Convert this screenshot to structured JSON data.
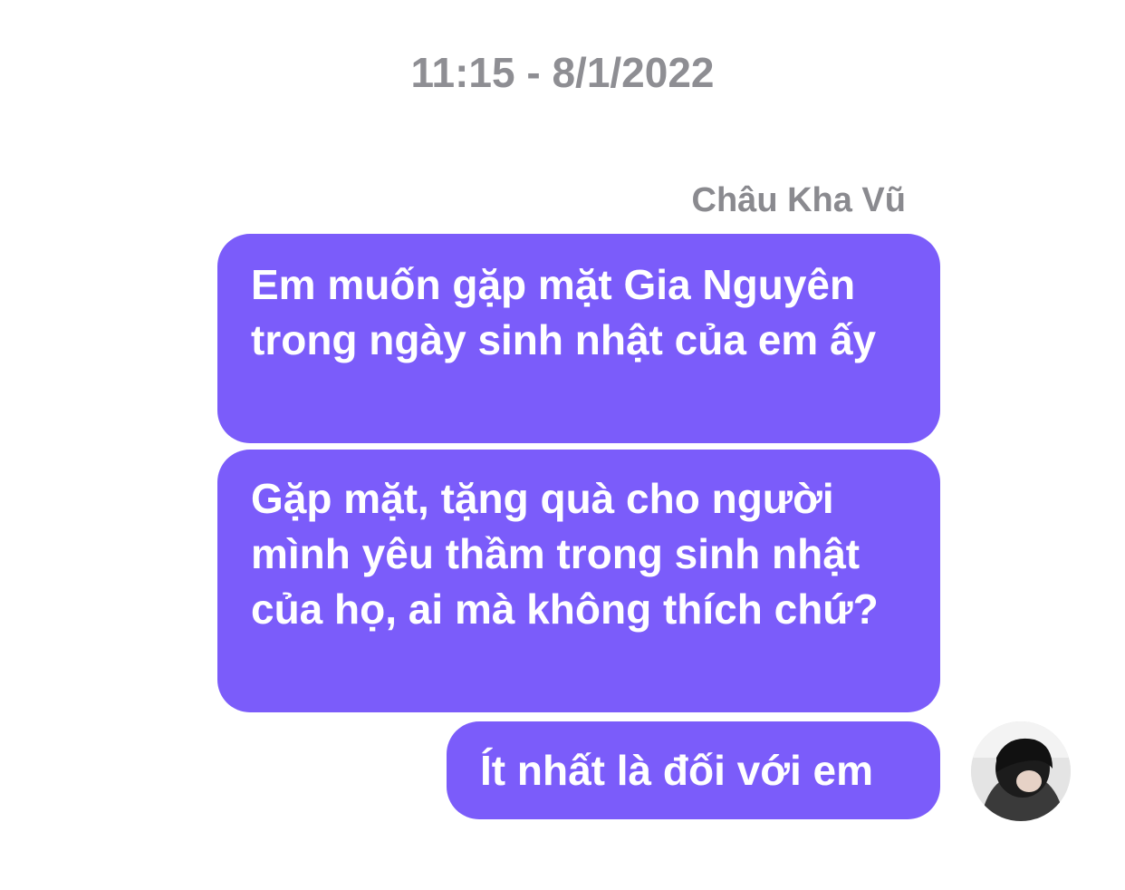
{
  "timestamp": "11:15 - 8/1/2022",
  "sender_name": "Châu Kha Vũ",
  "messages": [
    {
      "text": "Em muốn gặp mặt Gia Nguyên trong ngày sinh nhật của em ấy"
    },
    {
      "text": "Gặp mặt, tặng quà cho người mình yêu thầm trong sinh nhật của họ, ai mà không thích chứ?"
    },
    {
      "text": "Ít nhất là đối với em"
    }
  ],
  "colors": {
    "bubble": "#7b5cfa",
    "bubble_text": "#ffffff",
    "meta_text": "#8e8e93",
    "background": "#ffffff"
  },
  "avatar": {
    "icon": "user-photo-avatar"
  }
}
